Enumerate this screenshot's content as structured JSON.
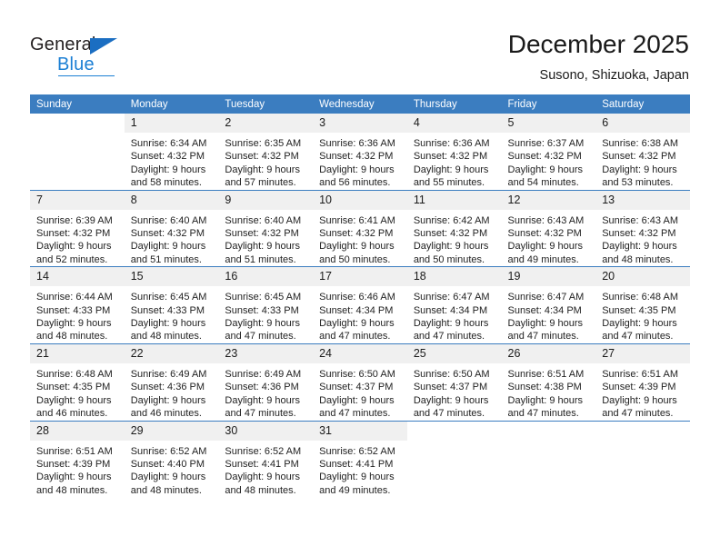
{
  "brand": {
    "name_top": "General",
    "name_bottom": "Blue",
    "triangle_color": "#1b6ec2",
    "blue_color": "#1b7fd4"
  },
  "header": {
    "title": "December 2025",
    "subtitle": "Susono, Shizuoka, Japan"
  },
  "theme": {
    "header_bg": "#3b7dc0",
    "header_text": "#ffffff",
    "daynum_bg": "#f0f0f0",
    "grid_line": "#3b7dc0",
    "cell_bg": "#ffffff"
  },
  "columns": [
    "Sunday",
    "Monday",
    "Tuesday",
    "Wednesday",
    "Thursday",
    "Friday",
    "Saturday"
  ],
  "weeks": [
    [
      {
        "day": "",
        "empty": true,
        "sunrise": "",
        "sunset": "",
        "daylight1": "",
        "daylight2": ""
      },
      {
        "day": "1",
        "sunrise": "Sunrise: 6:34 AM",
        "sunset": "Sunset: 4:32 PM",
        "daylight1": "Daylight: 9 hours",
        "daylight2": "and 58 minutes."
      },
      {
        "day": "2",
        "sunrise": "Sunrise: 6:35 AM",
        "sunset": "Sunset: 4:32 PM",
        "daylight1": "Daylight: 9 hours",
        "daylight2": "and 57 minutes."
      },
      {
        "day": "3",
        "sunrise": "Sunrise: 6:36 AM",
        "sunset": "Sunset: 4:32 PM",
        "daylight1": "Daylight: 9 hours",
        "daylight2": "and 56 minutes."
      },
      {
        "day": "4",
        "sunrise": "Sunrise: 6:36 AM",
        "sunset": "Sunset: 4:32 PM",
        "daylight1": "Daylight: 9 hours",
        "daylight2": "and 55 minutes."
      },
      {
        "day": "5",
        "sunrise": "Sunrise: 6:37 AM",
        "sunset": "Sunset: 4:32 PM",
        "daylight1": "Daylight: 9 hours",
        "daylight2": "and 54 minutes."
      },
      {
        "day": "6",
        "sunrise": "Sunrise: 6:38 AM",
        "sunset": "Sunset: 4:32 PM",
        "daylight1": "Daylight: 9 hours",
        "daylight2": "and 53 minutes."
      }
    ],
    [
      {
        "day": "7",
        "sunrise": "Sunrise: 6:39 AM",
        "sunset": "Sunset: 4:32 PM",
        "daylight1": "Daylight: 9 hours",
        "daylight2": "and 52 minutes."
      },
      {
        "day": "8",
        "sunrise": "Sunrise: 6:40 AM",
        "sunset": "Sunset: 4:32 PM",
        "daylight1": "Daylight: 9 hours",
        "daylight2": "and 51 minutes."
      },
      {
        "day": "9",
        "sunrise": "Sunrise: 6:40 AM",
        "sunset": "Sunset: 4:32 PM",
        "daylight1": "Daylight: 9 hours",
        "daylight2": "and 51 minutes."
      },
      {
        "day": "10",
        "sunrise": "Sunrise: 6:41 AM",
        "sunset": "Sunset: 4:32 PM",
        "daylight1": "Daylight: 9 hours",
        "daylight2": "and 50 minutes."
      },
      {
        "day": "11",
        "sunrise": "Sunrise: 6:42 AM",
        "sunset": "Sunset: 4:32 PM",
        "daylight1": "Daylight: 9 hours",
        "daylight2": "and 50 minutes."
      },
      {
        "day": "12",
        "sunrise": "Sunrise: 6:43 AM",
        "sunset": "Sunset: 4:32 PM",
        "daylight1": "Daylight: 9 hours",
        "daylight2": "and 49 minutes."
      },
      {
        "day": "13",
        "sunrise": "Sunrise: 6:43 AM",
        "sunset": "Sunset: 4:32 PM",
        "daylight1": "Daylight: 9 hours",
        "daylight2": "and 48 minutes."
      }
    ],
    [
      {
        "day": "14",
        "sunrise": "Sunrise: 6:44 AM",
        "sunset": "Sunset: 4:33 PM",
        "daylight1": "Daylight: 9 hours",
        "daylight2": "and 48 minutes."
      },
      {
        "day": "15",
        "sunrise": "Sunrise: 6:45 AM",
        "sunset": "Sunset: 4:33 PM",
        "daylight1": "Daylight: 9 hours",
        "daylight2": "and 48 minutes."
      },
      {
        "day": "16",
        "sunrise": "Sunrise: 6:45 AM",
        "sunset": "Sunset: 4:33 PM",
        "daylight1": "Daylight: 9 hours",
        "daylight2": "and 47 minutes."
      },
      {
        "day": "17",
        "sunrise": "Sunrise: 6:46 AM",
        "sunset": "Sunset: 4:34 PM",
        "daylight1": "Daylight: 9 hours",
        "daylight2": "and 47 minutes."
      },
      {
        "day": "18",
        "sunrise": "Sunrise: 6:47 AM",
        "sunset": "Sunset: 4:34 PM",
        "daylight1": "Daylight: 9 hours",
        "daylight2": "and 47 minutes."
      },
      {
        "day": "19",
        "sunrise": "Sunrise: 6:47 AM",
        "sunset": "Sunset: 4:34 PM",
        "daylight1": "Daylight: 9 hours",
        "daylight2": "and 47 minutes."
      },
      {
        "day": "20",
        "sunrise": "Sunrise: 6:48 AM",
        "sunset": "Sunset: 4:35 PM",
        "daylight1": "Daylight: 9 hours",
        "daylight2": "and 47 minutes."
      }
    ],
    [
      {
        "day": "21",
        "sunrise": "Sunrise: 6:48 AM",
        "sunset": "Sunset: 4:35 PM",
        "daylight1": "Daylight: 9 hours",
        "daylight2": "and 46 minutes."
      },
      {
        "day": "22",
        "sunrise": "Sunrise: 6:49 AM",
        "sunset": "Sunset: 4:36 PM",
        "daylight1": "Daylight: 9 hours",
        "daylight2": "and 46 minutes."
      },
      {
        "day": "23",
        "sunrise": "Sunrise: 6:49 AM",
        "sunset": "Sunset: 4:36 PM",
        "daylight1": "Daylight: 9 hours",
        "daylight2": "and 47 minutes."
      },
      {
        "day": "24",
        "sunrise": "Sunrise: 6:50 AM",
        "sunset": "Sunset: 4:37 PM",
        "daylight1": "Daylight: 9 hours",
        "daylight2": "and 47 minutes."
      },
      {
        "day": "25",
        "sunrise": "Sunrise: 6:50 AM",
        "sunset": "Sunset: 4:37 PM",
        "daylight1": "Daylight: 9 hours",
        "daylight2": "and 47 minutes."
      },
      {
        "day": "26",
        "sunrise": "Sunrise: 6:51 AM",
        "sunset": "Sunset: 4:38 PM",
        "daylight1": "Daylight: 9 hours",
        "daylight2": "and 47 minutes."
      },
      {
        "day": "27",
        "sunrise": "Sunrise: 6:51 AM",
        "sunset": "Sunset: 4:39 PM",
        "daylight1": "Daylight: 9 hours",
        "daylight2": "and 47 minutes."
      }
    ],
    [
      {
        "day": "28",
        "sunrise": "Sunrise: 6:51 AM",
        "sunset": "Sunset: 4:39 PM",
        "daylight1": "Daylight: 9 hours",
        "daylight2": "and 48 minutes."
      },
      {
        "day": "29",
        "sunrise": "Sunrise: 6:52 AM",
        "sunset": "Sunset: 4:40 PM",
        "daylight1": "Daylight: 9 hours",
        "daylight2": "and 48 minutes."
      },
      {
        "day": "30",
        "sunrise": "Sunrise: 6:52 AM",
        "sunset": "Sunset: 4:41 PM",
        "daylight1": "Daylight: 9 hours",
        "daylight2": "and 48 minutes."
      },
      {
        "day": "31",
        "sunrise": "Sunrise: 6:52 AM",
        "sunset": "Sunset: 4:41 PM",
        "daylight1": "Daylight: 9 hours",
        "daylight2": "and 49 minutes."
      },
      {
        "day": "",
        "empty": true,
        "sunrise": "",
        "sunset": "",
        "daylight1": "",
        "daylight2": ""
      },
      {
        "day": "",
        "empty": true,
        "sunrise": "",
        "sunset": "",
        "daylight1": "",
        "daylight2": ""
      },
      {
        "day": "",
        "empty": true,
        "sunrise": "",
        "sunset": "",
        "daylight1": "",
        "daylight2": ""
      }
    ]
  ]
}
